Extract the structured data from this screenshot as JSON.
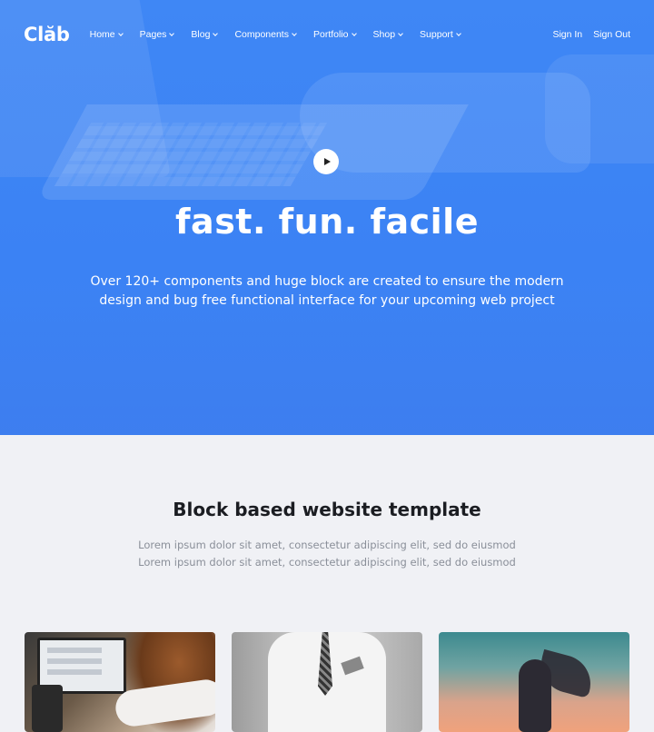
{
  "nav": {
    "logo": "Clăb",
    "items": [
      {
        "label": "Home"
      },
      {
        "label": "Pages"
      },
      {
        "label": "Blog"
      },
      {
        "label": "Components"
      },
      {
        "label": "Portfolio"
      },
      {
        "label": "Shop"
      },
      {
        "label": "Support"
      }
    ],
    "sign_in": "Sign In",
    "sign_out": "Sign Out"
  },
  "hero": {
    "title": "fast. fun. facile",
    "subtitle": "Over 120+ components and huge block are created to ensure the modern design and bug free functional interface for your upcoming web project",
    "play_icon": "play-icon",
    "accent_color": "#3d84f4"
  },
  "section": {
    "title": "Block based website template",
    "text": "Lorem ipsum dolor sit amet, consectetur adipiscing elit, sed do eiusmod Lorem ipsum dolor sit amet, consectetur adipiscing elit, sed do eiusmod"
  }
}
